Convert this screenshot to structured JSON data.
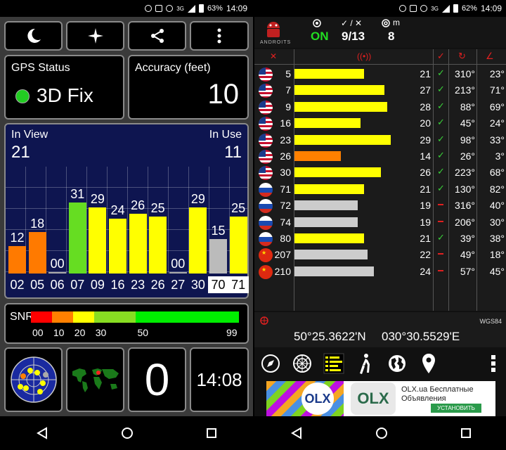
{
  "left_status": {
    "battery": "63%",
    "time": "14:09",
    "network": "3G"
  },
  "right_status": {
    "battery": "62%",
    "time": "14:09",
    "network": "3G"
  },
  "gps_status": {
    "title": "GPS Status",
    "value": "3D Fix",
    "indicator_color": "#22cc22"
  },
  "accuracy": {
    "title": "Accuracy (feet)",
    "value": "10"
  },
  "satellites": {
    "in_view_label": "In View",
    "in_view": "21",
    "in_use_label": "In Use",
    "in_use": "11"
  },
  "chart_data": {
    "type": "bar",
    "categories": [
      "02",
      "05",
      "06",
      "07",
      "09",
      "16",
      "23",
      "26",
      "27",
      "30",
      "70",
      "71"
    ],
    "values": [
      12,
      18,
      0,
      31,
      29,
      24,
      26,
      25,
      0,
      29,
      15,
      25
    ],
    "value_labels": [
      "12",
      "18",
      "00",
      "31",
      "29",
      "24",
      "26",
      "25",
      "00",
      "29",
      "15",
      "25"
    ],
    "colors": [
      "#ff7a00",
      "#ff7a00",
      "#aaaaaa",
      "#66dd22",
      "#ffff00",
      "#ffff00",
      "#ffff00",
      "#ffff00",
      "#aaaaaa",
      "#ffff00",
      "#bbbbbb",
      "#ffff00"
    ],
    "highlighted": [
      "70",
      "71"
    ],
    "ylim": [
      0,
      40
    ]
  },
  "snr": {
    "label": "SNR",
    "ticks": [
      "00",
      "10",
      "20",
      "30",
      "50",
      "99"
    ],
    "colors": [
      "#ff0000",
      "#ff8000",
      "#ffff00",
      "#88dd22",
      "#00ee00"
    ]
  },
  "bottom_tiles": {
    "count": "0",
    "time": "14:08"
  },
  "right_header": {
    "on_label": "ON",
    "used_total": "9/13",
    "count": "8",
    "logo_text": "ANDROITS",
    "m_label": "m"
  },
  "sat_table": [
    {
      "flag": "us",
      "prn": "5",
      "snr": "21",
      "used": true,
      "azimuth": "310°",
      "elevation": "23°",
      "bar": 21,
      "color": "#ffff00"
    },
    {
      "flag": "us",
      "prn": "7",
      "snr": "27",
      "used": true,
      "azimuth": "213°",
      "elevation": "71°",
      "bar": 27,
      "color": "#ffff00"
    },
    {
      "flag": "us",
      "prn": "9",
      "snr": "28",
      "used": true,
      "azimuth": "88°",
      "elevation": "69°",
      "bar": 28,
      "color": "#ffff00"
    },
    {
      "flag": "us",
      "prn": "16",
      "snr": "20",
      "used": true,
      "azimuth": "45°",
      "elevation": "24°",
      "bar": 20,
      "color": "#ffff00"
    },
    {
      "flag": "us",
      "prn": "23",
      "snr": "29",
      "used": true,
      "azimuth": "98°",
      "elevation": "33°",
      "bar": 29,
      "color": "#ffff00"
    },
    {
      "flag": "us",
      "prn": "26",
      "snr": "14",
      "used": true,
      "azimuth": "26°",
      "elevation": "3°",
      "bar": 14,
      "color": "#ff8000"
    },
    {
      "flag": "us",
      "prn": "30",
      "snr": "26",
      "used": true,
      "azimuth": "223°",
      "elevation": "68°",
      "bar": 26,
      "color": "#ffff00"
    },
    {
      "flag": "ru",
      "prn": "71",
      "snr": "21",
      "used": true,
      "azimuth": "130°",
      "elevation": "82°",
      "bar": 21,
      "color": "#ffff00"
    },
    {
      "flag": "ru",
      "prn": "72",
      "snr": "19",
      "used": false,
      "azimuth": "316°",
      "elevation": "40°",
      "bar": 19,
      "color": "#cccccc"
    },
    {
      "flag": "ru",
      "prn": "74",
      "snr": "19",
      "used": false,
      "azimuth": "206°",
      "elevation": "30°",
      "bar": 19,
      "color": "#cccccc"
    },
    {
      "flag": "ru",
      "prn": "80",
      "snr": "21",
      "used": true,
      "azimuth": "39°",
      "elevation": "38°",
      "bar": 21,
      "color": "#ffff00"
    },
    {
      "flag": "cn",
      "prn": "207",
      "snr": "22",
      "used": false,
      "azimuth": "49°",
      "elevation": "18°",
      "bar": 22,
      "color": "#cccccc"
    },
    {
      "flag": "cn",
      "prn": "210",
      "snr": "24",
      "used": false,
      "azimuth": "57°",
      "elevation": "45°",
      "bar": 24,
      "color": "#cccccc"
    }
  ],
  "coordinates": {
    "datum": "WGS84",
    "lat": "50°25.3622'N",
    "lon": "030°30.5529'E"
  },
  "toolbar": [
    "compass-icon",
    "radar-icon",
    "bars-icon",
    "walk-icon",
    "globe-icon",
    "pin-icon",
    "more-icon"
  ],
  "ad": {
    "brand": "OLX",
    "title": "OLX.ua Бесплатные",
    "subtitle": "Объявления",
    "cta": "УСТАНОВИТЬ"
  }
}
